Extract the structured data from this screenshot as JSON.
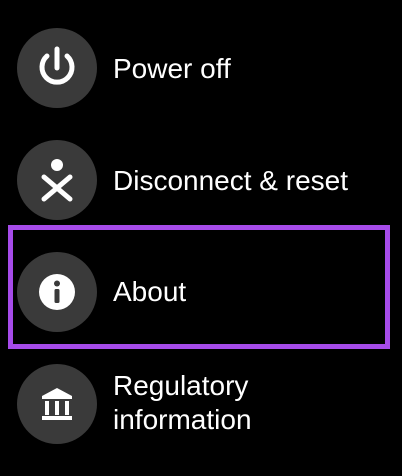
{
  "menu": {
    "items": [
      {
        "label": "Power off",
        "icon": "power-icon"
      },
      {
        "label": "Disconnect & reset",
        "icon": "disconnect-reset-icon"
      },
      {
        "label": "About",
        "icon": "info-icon"
      },
      {
        "label_line1": "Regulatory",
        "label_line2": "information",
        "icon": "bank-icon"
      }
    ]
  },
  "highlight": {
    "color": "#a64bea",
    "target": "About"
  },
  "colors": {
    "background": "#000000",
    "icon_circle": "#3a3a3a",
    "text": "#ffffff"
  }
}
